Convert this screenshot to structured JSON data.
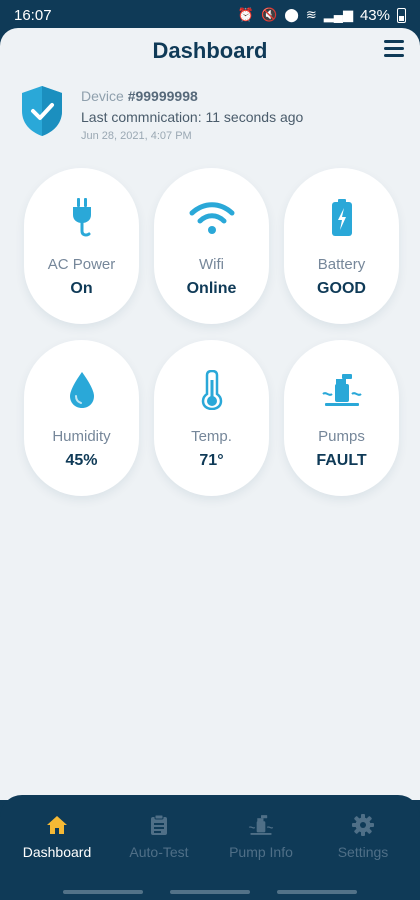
{
  "status_bar": {
    "time": "16:07",
    "battery": "43%"
  },
  "header": {
    "title": "Dashboard"
  },
  "device": {
    "label": "Device",
    "id": "#99999998",
    "communication": "Last commnication: 11 seconds ago",
    "timestamp": "Jun 28, 2021, 4:07 PM"
  },
  "tiles": [
    {
      "icon": "plug-icon",
      "label": "AC Power",
      "value": "On"
    },
    {
      "icon": "wifi-icon",
      "label": "Wifi",
      "value": "Online"
    },
    {
      "icon": "battery-icon",
      "label": "Battery",
      "value": "GOOD"
    },
    {
      "icon": "water-drop-icon",
      "label": "Humidity",
      "value": "45%"
    },
    {
      "icon": "thermometer-icon",
      "label": "Temp.",
      "value": "71°"
    },
    {
      "icon": "pump-icon",
      "label": "Pumps",
      "value": "FAULT"
    }
  ],
  "nav": [
    {
      "icon": "home-icon",
      "label": "Dashboard",
      "active": true
    },
    {
      "icon": "clipboard-icon",
      "label": "Auto-Test",
      "active": false
    },
    {
      "icon": "pump-icon",
      "label": "Pump Info",
      "active": false
    },
    {
      "icon": "gear-icon",
      "label": "Settings",
      "active": false
    }
  ],
  "colors": {
    "accent": "#2aa8d8",
    "primary": "#0f3a57",
    "active_nav_icon": "#f5b935",
    "background": "#eef2f5"
  }
}
